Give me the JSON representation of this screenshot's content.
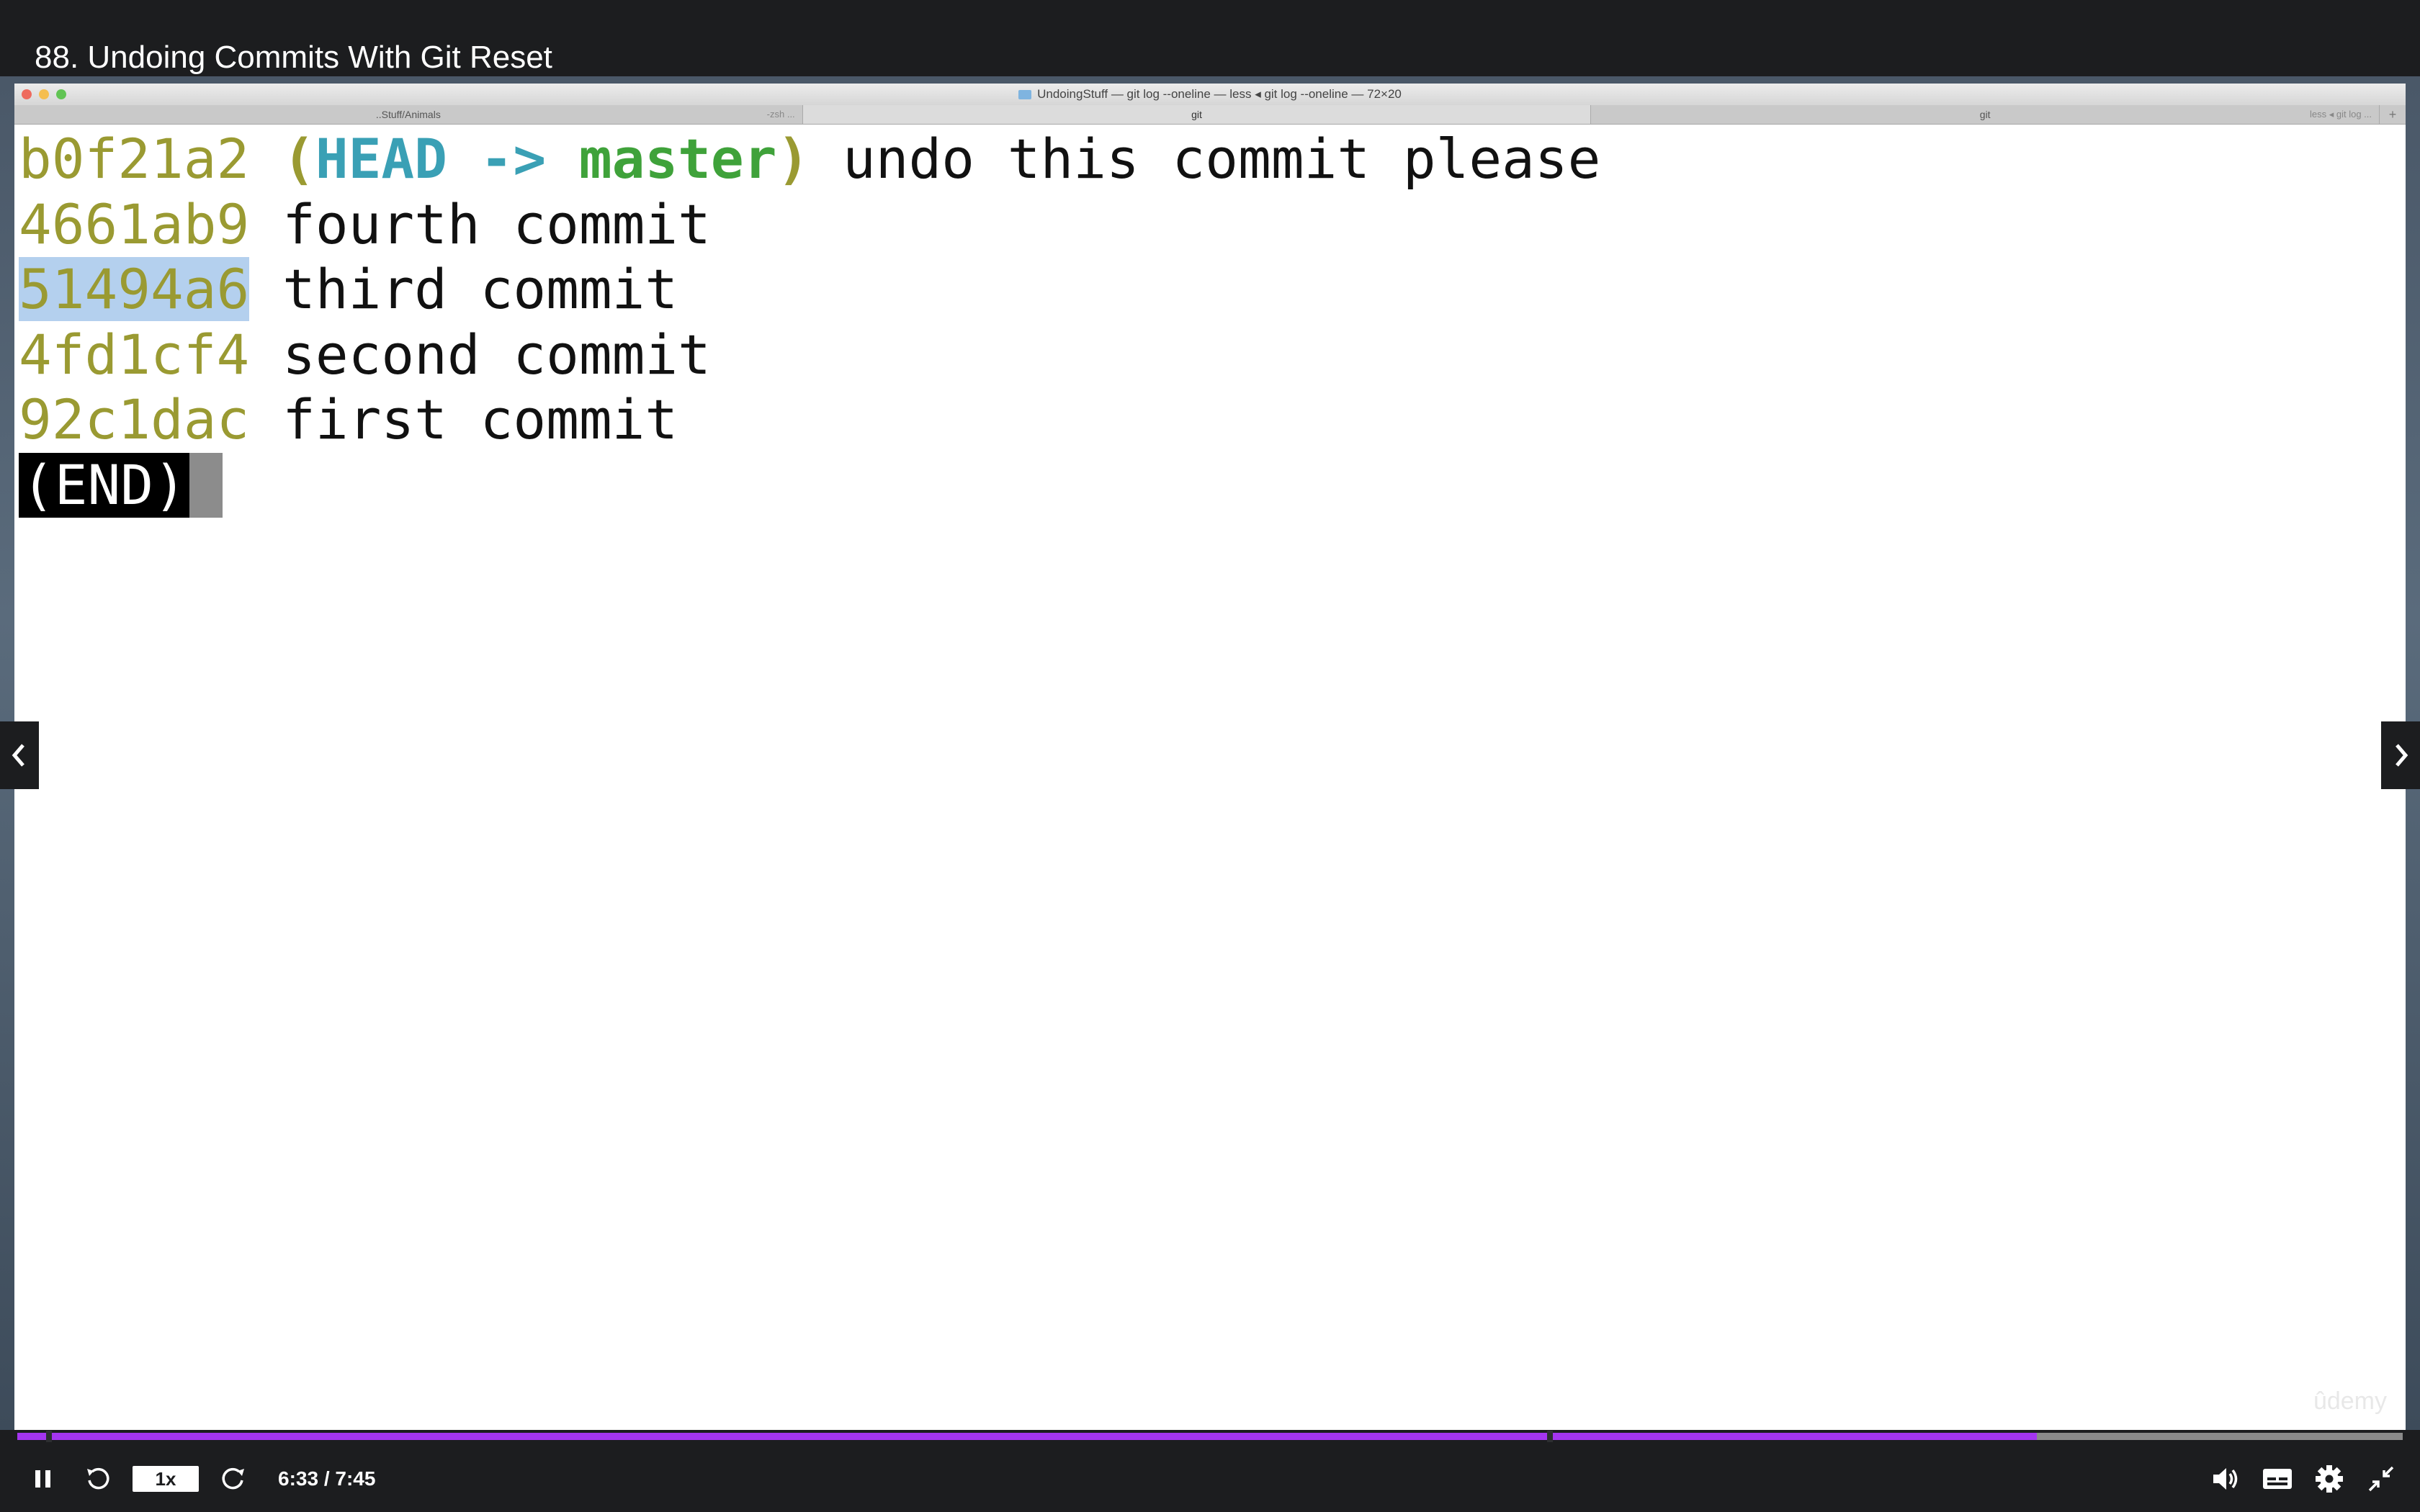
{
  "video": {
    "title": "88. Undoing Commits With Git Reset",
    "watermark": "ûdemy"
  },
  "window": {
    "title": "UndoingStuff — git log --oneline — less ◂ git log --oneline — 72×20"
  },
  "tabs": [
    {
      "label": "..Stuff/Animals",
      "sub": "-zsh ..."
    },
    {
      "label": "git",
      "sub": ""
    },
    {
      "label": "git",
      "sub": "less ◂ git log ..."
    }
  ],
  "tab_add_label": "+",
  "terminal": {
    "head_ref": "HEAD",
    "ref_arrow": "->",
    "branch": "master",
    "paren_open": "(",
    "paren_close": ")",
    "lines": [
      {
        "hash": "b0f21a2",
        "message": "undo this commit please"
      },
      {
        "hash": "4661ab9",
        "message": "fourth commit"
      },
      {
        "hash": "51494a6",
        "message": "third commit",
        "selected": true
      },
      {
        "hash": "4fd1cf4",
        "message": "second commit"
      },
      {
        "hash": "92c1dac",
        "message": "first commit"
      }
    ],
    "end_prompt": "(END)"
  },
  "player": {
    "progress_fraction": 0.8467,
    "speed_label": "1x",
    "time_label": "6:33 / 7:45",
    "accent_color": "#a435f0"
  },
  "icons": {
    "pause": "pause-icon",
    "rewind": "rewind-5-icon",
    "forward": "forward-5-icon",
    "volume": "volume-icon",
    "captions": "captions-icon",
    "settings": "gear-icon",
    "exit_fullscreen": "exit-fullscreen-icon",
    "prev": "chevron-left-icon",
    "next": "chevron-right-icon"
  }
}
